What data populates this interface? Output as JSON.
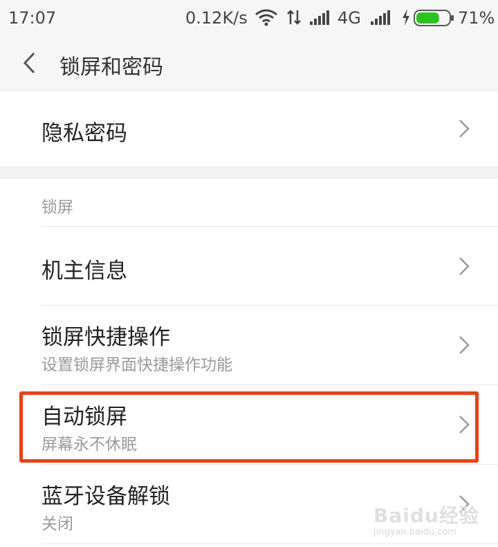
{
  "status_bar": {
    "time": "17:07",
    "net_speed": "0.12K/s",
    "network": "4G",
    "battery": "71%",
    "battery_level": 0.71,
    "battery_color": "#2dc31e",
    "icons": [
      "wifi-icon",
      "data-transfer-icon",
      "signal-icon",
      "signal-icon",
      "charging-icon",
      "battery-icon"
    ]
  },
  "header": {
    "title": "锁屏和密码",
    "back_icon": "chevron-left-icon"
  },
  "privacy": {
    "label": "隐私密码"
  },
  "section": {
    "title": "锁屏"
  },
  "items": [
    {
      "label": "机主信息",
      "sub": ""
    },
    {
      "label": "锁屏快捷操作",
      "sub": "设置锁屏界面快捷操作功能"
    },
    {
      "label": "自动锁屏",
      "sub": "屏幕永不休眠"
    },
    {
      "label": "蓝牙设备解锁",
      "sub": "关闭"
    }
  ],
  "highlight_color": "#e8401c",
  "watermark": {
    "logo": "Baidu经验",
    "url": "jingyan.baidu.com"
  }
}
